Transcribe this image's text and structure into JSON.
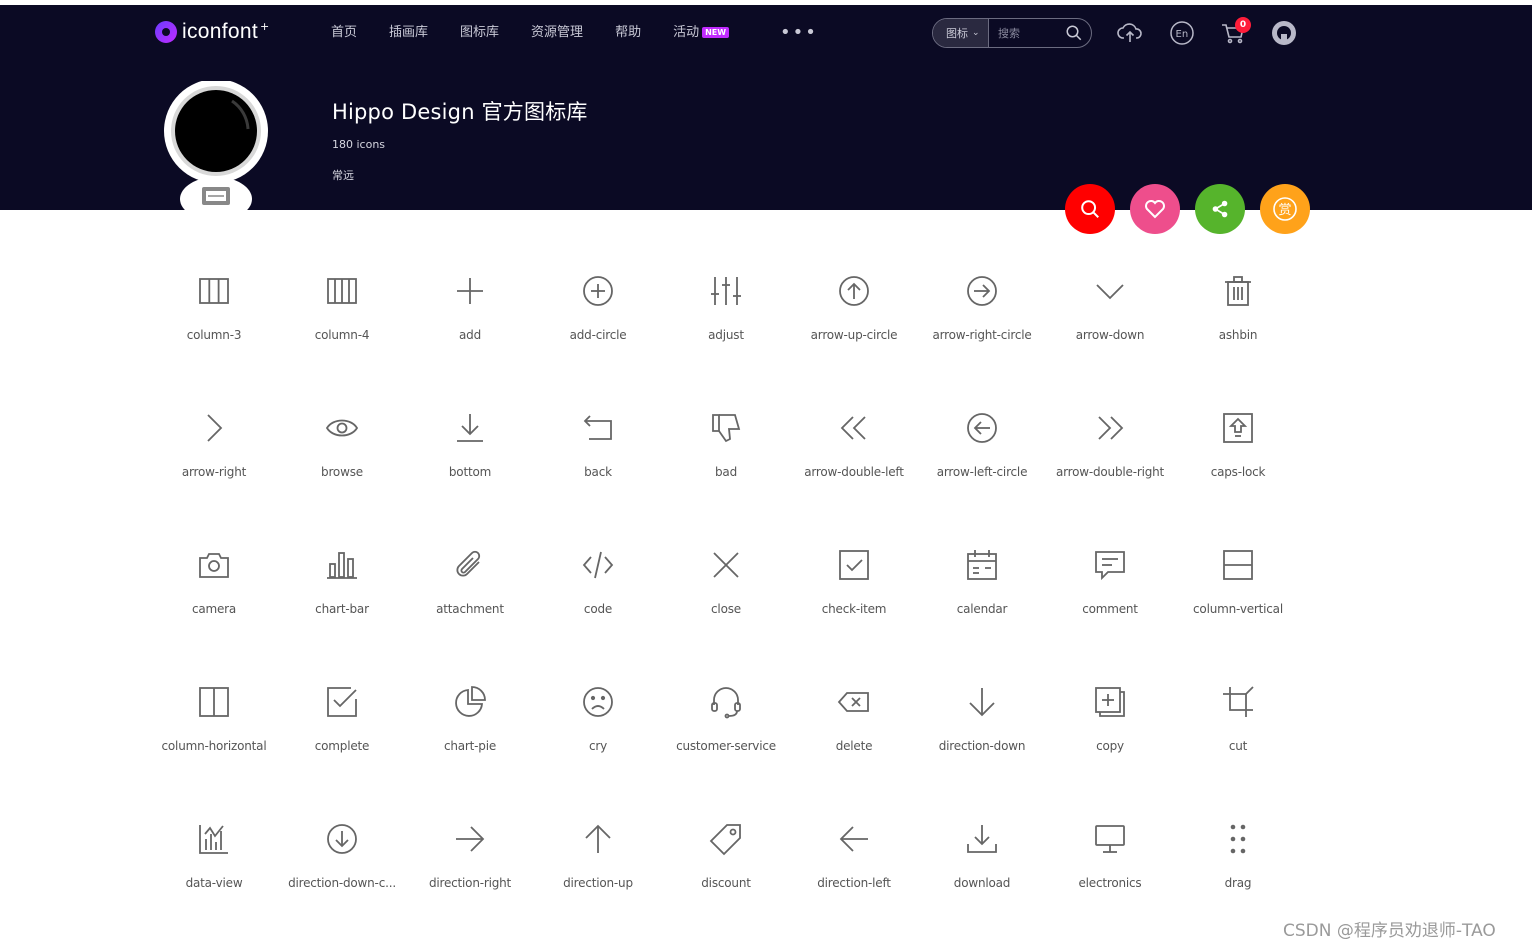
{
  "header": {
    "logo_text": "iconfont",
    "logo_plus": "+",
    "nav": [
      {
        "label": "首页"
      },
      {
        "label": "插画库"
      },
      {
        "label": "图标库"
      },
      {
        "label": "资源管理"
      },
      {
        "label": "帮助"
      },
      {
        "label": "活动",
        "badge": "NEW"
      }
    ],
    "nav_more": "•••",
    "search": {
      "type": "图标",
      "placeholder": "搜索"
    },
    "cart_count": "0"
  },
  "library": {
    "title": "Hippo Design 官方图标库",
    "count": "180 icons",
    "author": "常远"
  },
  "actions": {
    "colors": {
      "search": "#ff0000",
      "favorite": "#ee4e8c",
      "share": "#56b42c",
      "reward": "#ffa21a"
    },
    "reward_glyph": "赏"
  },
  "icons": [
    {
      "name": "column-3",
      "icon": "column-3-icon"
    },
    {
      "name": "column-4",
      "icon": "column-4-icon"
    },
    {
      "name": "add",
      "icon": "add-icon"
    },
    {
      "name": "add-circle",
      "icon": "add-circle-icon"
    },
    {
      "name": "adjust",
      "icon": "adjust-icon"
    },
    {
      "name": "arrow-up-circle",
      "icon": "arrow-up-circle-icon"
    },
    {
      "name": "arrow-right-circle",
      "icon": "arrow-right-circle-icon"
    },
    {
      "name": "arrow-down",
      "icon": "arrow-down-icon"
    },
    {
      "name": "ashbin",
      "icon": "ashbin-icon"
    },
    {
      "name": "arrow-right",
      "icon": "arrow-right-icon"
    },
    {
      "name": "browse",
      "icon": "browse-icon"
    },
    {
      "name": "bottom",
      "icon": "bottom-icon"
    },
    {
      "name": "back",
      "icon": "back-icon"
    },
    {
      "name": "bad",
      "icon": "bad-icon"
    },
    {
      "name": "arrow-double-left",
      "icon": "arrow-double-left-icon"
    },
    {
      "name": "arrow-left-circle",
      "icon": "arrow-left-circle-icon"
    },
    {
      "name": "arrow-double-right",
      "icon": "arrow-double-right-icon"
    },
    {
      "name": "caps-lock",
      "icon": "caps-lock-icon"
    },
    {
      "name": "camera",
      "icon": "camera-icon"
    },
    {
      "name": "chart-bar",
      "icon": "chart-bar-icon"
    },
    {
      "name": "attachment",
      "icon": "attachment-icon"
    },
    {
      "name": "code",
      "icon": "code-icon"
    },
    {
      "name": "close",
      "icon": "close-icon"
    },
    {
      "name": "check-item",
      "icon": "check-item-icon"
    },
    {
      "name": "calendar",
      "icon": "calendar-icon"
    },
    {
      "name": "comment",
      "icon": "comment-icon"
    },
    {
      "name": "column-vertical",
      "icon": "column-vertical-icon"
    },
    {
      "name": "column-horizontal",
      "icon": "column-horizontal-icon"
    },
    {
      "name": "complete",
      "icon": "complete-icon"
    },
    {
      "name": "chart-pie",
      "icon": "chart-pie-icon"
    },
    {
      "name": "cry",
      "icon": "cry-icon"
    },
    {
      "name": "customer-service",
      "icon": "customer-service-icon"
    },
    {
      "name": "delete",
      "icon": "delete-icon"
    },
    {
      "name": "direction-down",
      "icon": "direction-down-icon"
    },
    {
      "name": "copy",
      "icon": "copy-icon"
    },
    {
      "name": "cut",
      "icon": "cut-icon"
    },
    {
      "name": "data-view",
      "icon": "data-view-icon"
    },
    {
      "name": "direction-down-c...",
      "icon": "direction-down-circle-icon"
    },
    {
      "name": "direction-right",
      "icon": "direction-right-icon"
    },
    {
      "name": "direction-up",
      "icon": "direction-up-icon"
    },
    {
      "name": "discount",
      "icon": "discount-icon"
    },
    {
      "name": "direction-left",
      "icon": "direction-left-icon"
    },
    {
      "name": "download",
      "icon": "download-icon"
    },
    {
      "name": "electronics",
      "icon": "electronics-icon"
    },
    {
      "name": "drag",
      "icon": "drag-icon"
    }
  ],
  "watermark": "CSDN @程序员劝退师-TAO"
}
